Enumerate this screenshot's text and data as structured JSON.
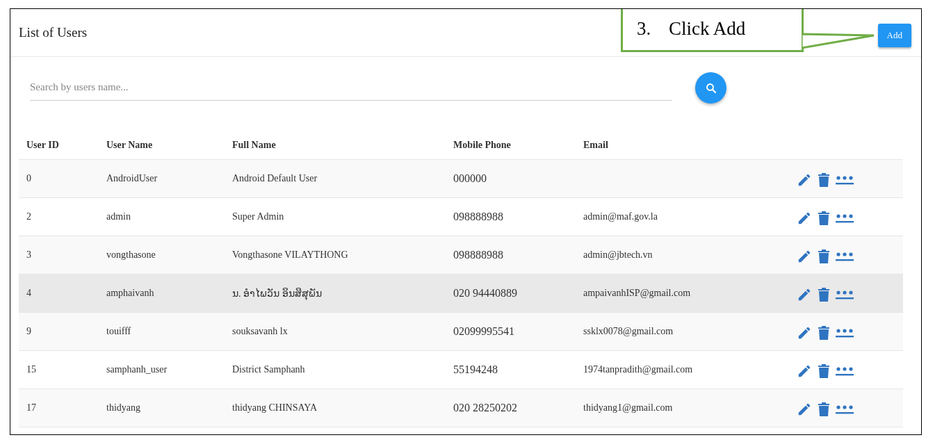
{
  "title": "List of Users",
  "callout": {
    "number": "3.",
    "text": "Click Add"
  },
  "add_button": "Add",
  "search": {
    "placeholder": "Search by users name..."
  },
  "table": {
    "columns": [
      "User ID",
      "User Name",
      "Full Name",
      "Mobile Phone",
      "Email"
    ],
    "rows": [
      {
        "cells": [
          "0",
          "AndroidUser",
          "Android Default User",
          "000000",
          ""
        ],
        "highlighted": false
      },
      {
        "cells": [
          "2",
          "admin",
          "Super Admin",
          "098888988",
          "admin@maf.gov.la"
        ],
        "highlighted": false
      },
      {
        "cells": [
          "3",
          "vongthasone",
          "Vongthasone VILAYTHONG",
          "098888988",
          "admin@jbtech.vn"
        ],
        "highlighted": false
      },
      {
        "cells": [
          "4",
          "amphaivanh",
          "ນ. ອຳໄພວັນ ອິນສິສຸພັນ",
          "020 94440889",
          "ampaivanhISP@gmail.com"
        ],
        "highlighted": true
      },
      {
        "cells": [
          "9",
          "touifff",
          "souksavanh lx",
          "02099995541",
          "ssklx0078@gmail.com"
        ],
        "highlighted": false
      },
      {
        "cells": [
          "15",
          "samphanh_user",
          "District Samphanh",
          "55194248",
          "1974tanpradith@gmail.com"
        ],
        "highlighted": false
      },
      {
        "cells": [
          "17",
          "thidyang",
          "thidyang CHINSAYA",
          "020 28250202",
          "thidyang1@gmail.com"
        ],
        "highlighted": false
      }
    ]
  }
}
